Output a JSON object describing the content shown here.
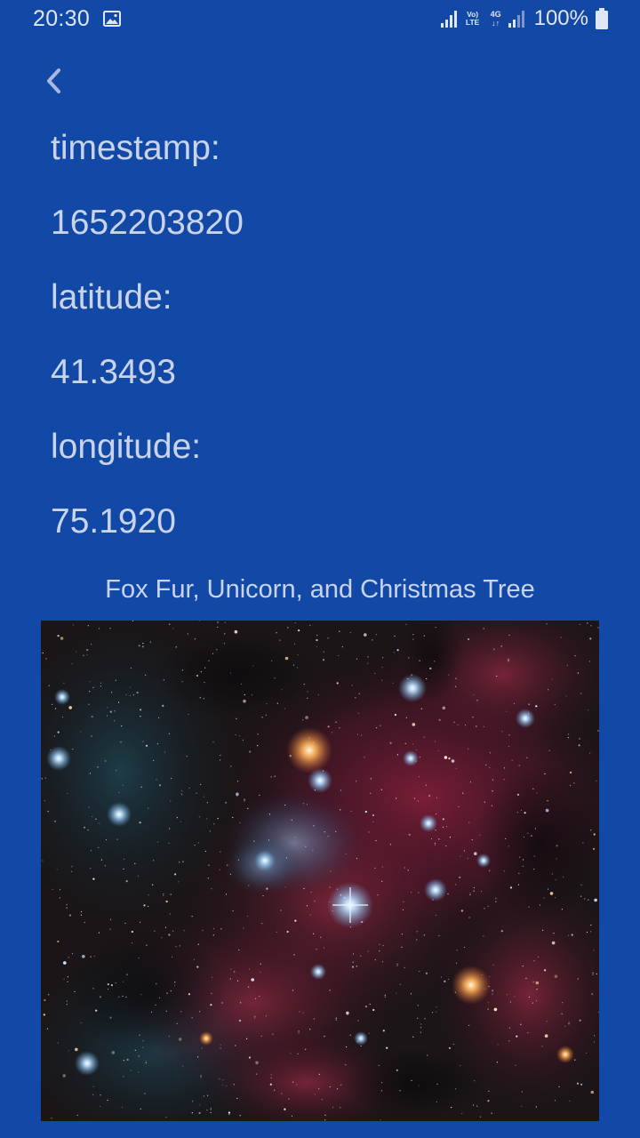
{
  "status_bar": {
    "time": "20:30",
    "lte_top": "Vo)",
    "lte_bottom": "LTE",
    "net_top": "4G",
    "net_bottom": "↓↑",
    "battery": "100%"
  },
  "details": {
    "timestamp_label": "timestamp:",
    "timestamp_value": "1652203820",
    "latitude_label": "latitude:",
    "latitude_value": "41.3493",
    "longitude_label": "longitude:",
    "longitude_value": "75.1920"
  },
  "image": {
    "caption": "Fox Fur, Unicorn, and Christmas Tree"
  },
  "colors": {
    "background": "#1349a6",
    "text": "#c9d4ea"
  }
}
